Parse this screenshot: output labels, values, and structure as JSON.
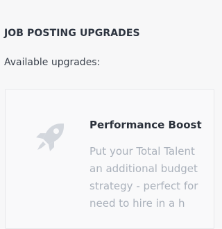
{
  "section": {
    "title": "JOB POSTING UPGRADES",
    "subtitle": "Available upgrades:"
  },
  "upgrade": {
    "icon": "rocket-icon",
    "title": "Performance Boost",
    "description_lines": [
      "Put your Total Talent",
      "an additional budget",
      "strategy - perfect for",
      "need to hire in a h"
    ]
  },
  "colors": {
    "background": "#f7f7f8",
    "heading": "#2d3440",
    "muted_text": "#aab1bb",
    "icon": "#d3d7dd"
  }
}
